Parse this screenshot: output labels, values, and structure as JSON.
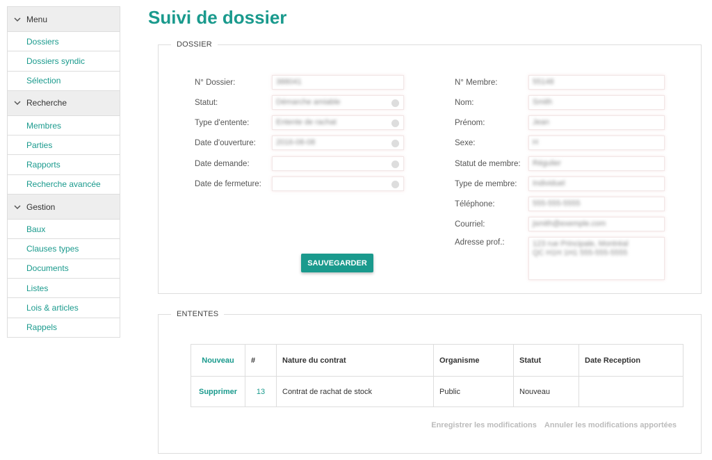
{
  "sidebar": {
    "groups": [
      {
        "title": "Menu",
        "items": [
          "Dossiers",
          "Dossiers syndic",
          "Sélection"
        ]
      },
      {
        "title": "Recherche",
        "items": [
          "Membres",
          "Parties",
          "Rapports",
          "Recherche avancée"
        ]
      },
      {
        "title": "Gestion",
        "items": [
          "Baux",
          "Clauses types",
          "Documents",
          "Listes",
          "Lois & articles",
          "Rappels"
        ]
      }
    ]
  },
  "page": {
    "title": "Suivi de dossier"
  },
  "dossier": {
    "legend": "DOSSIER",
    "left_fields": [
      {
        "label": "N° Dossier:",
        "value": "388041"
      },
      {
        "label": "Statut:",
        "value": "Démarche amiable"
      },
      {
        "label": "Type d'entente:",
        "value": "Entente de rachat"
      },
      {
        "label": "Date d'ouverture:",
        "value": "2016-08-08"
      },
      {
        "label": "Date demande:",
        "value": ""
      },
      {
        "label": "Date de fermeture:",
        "value": ""
      }
    ],
    "right_fields": [
      {
        "label": "N° Membre:",
        "value": "55148"
      },
      {
        "label": "Nom:",
        "value": "Smith"
      },
      {
        "label": "Prénom:",
        "value": "Jean"
      },
      {
        "label": "Sexe:",
        "value": "H"
      },
      {
        "label": "Statut de membre:",
        "value": "Régulier"
      },
      {
        "label": "Type de membre:",
        "value": "Individuel"
      },
      {
        "label": "Téléphone:",
        "value": "555-555-5555"
      },
      {
        "label": "Courriel:",
        "value": "jsmith@exemple.com"
      },
      {
        "label": "Adresse prof.:",
        "value": "123 rue Principale, Montréal QC H1H 1H1 555-555-5555"
      }
    ],
    "save_label": "SAUVEGARDER"
  },
  "ententes": {
    "legend": "ENTENTES",
    "columns": [
      "Nouveau",
      "#",
      "Nature du contrat",
      "Organisme",
      "Statut",
      "Date Reception"
    ],
    "rows": [
      {
        "action": "Supprimer",
        "num": "13",
        "nature": "Contrat de rachat de stock",
        "organisme": "Public",
        "statut": "Nouveau",
        "date": ""
      }
    ],
    "save_changes": "Enregistrer les modifications",
    "cancel_changes": "Annuler les modifications apportées"
  },
  "icons": {
    "group_toggle": "chevron-down-icon",
    "clear": "clear-icon"
  },
  "colors": {
    "accent": "#1a9a8d"
  }
}
